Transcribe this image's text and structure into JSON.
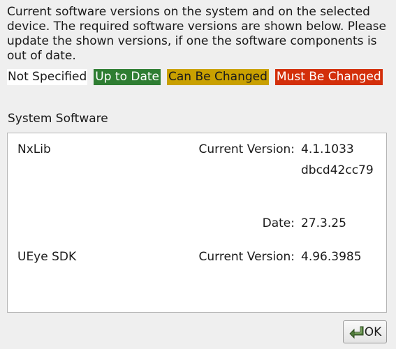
{
  "intro_text": "Current software versions on the system and on the selected device. The required software versions are shown below. Please update the shown versions, if one the software components is out of date.",
  "legend": {
    "not_specified": "Not Specified",
    "up_to_date": "Up to Date",
    "can_be_changed": "Can Be Changed",
    "must_be_changed": "Must Be Changed"
  },
  "colors": {
    "up_to_date": "#2e7d32",
    "can_be_changed": "#c9a000",
    "must_be_changed": "#d32f0b"
  },
  "section_title": "System Software",
  "software": [
    {
      "name": "NxLib",
      "current_version_label": "Current Version:",
      "current_version": "4.1.1033",
      "hash": "dbcd42cc79",
      "date_label": "Date:",
      "date": "27.3.25"
    },
    {
      "name": "UEye SDK",
      "current_version_label": "Current Version:",
      "current_version": "4.96.3985"
    }
  ],
  "ok_button": {
    "label": "OK",
    "icon": "enter-arrow-icon"
  }
}
